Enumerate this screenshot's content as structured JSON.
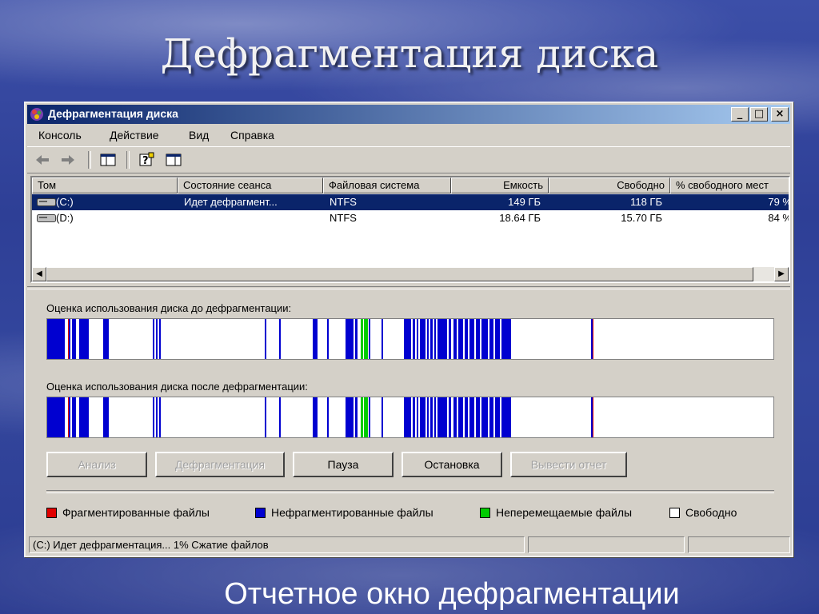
{
  "slide": {
    "title": "Дефрагментация диска",
    "caption": "Отчетное окно  дефрагментации"
  },
  "window": {
    "title": "Дефрагментация диска",
    "controls": {
      "minimize": "_",
      "maximize": "□",
      "close": "×"
    }
  },
  "menu": [
    "Консоль",
    "Действие",
    "Вид",
    "Справка"
  ],
  "toolbar": {
    "icons": [
      "back-arrow-icon",
      "forward-arrow-icon",
      "show-hide-tree-icon",
      "help-icon",
      "properties-icon"
    ]
  },
  "volumes": {
    "columns": [
      "Том",
      "Состояние сеанса",
      "Файловая система",
      "Емкость",
      "Свободно",
      "% свободного мест"
    ],
    "rows": [
      {
        "volume": "(C:)",
        "state": "Идет дефрагмент...",
        "fs": "NTFS",
        "capacity": "149 ГБ",
        "free": "118 ГБ",
        "percent": "79 %",
        "selected": true
      },
      {
        "volume": "(D:)",
        "state": "",
        "fs": "NTFS",
        "capacity": "18.64 ГБ",
        "free": "15.70 ГБ",
        "percent": "84 %",
        "selected": false
      }
    ]
  },
  "analysis": {
    "before_label": "Оценка использования диска до дефрагментации:",
    "after_label": "Оценка использования диска после дефрагментации:"
  },
  "buttons": [
    {
      "label": "Анализ",
      "enabled": false
    },
    {
      "label": "Дефрагментация",
      "enabled": false
    },
    {
      "label": "Пауза",
      "enabled": true
    },
    {
      "label": "Остановка",
      "enabled": true
    },
    {
      "label": "Вывести отчет",
      "enabled": false
    }
  ],
  "legend": [
    {
      "label": "Фрагментированные файлы",
      "color": "#e00000"
    },
    {
      "label": "Нефрагментированные файлы",
      "color": "#0000d0"
    },
    {
      "label": "Неперемещаемые файлы",
      "color": "#00cc00"
    },
    {
      "label": "Свободно",
      "color": "#ffffff"
    }
  ],
  "status": {
    "text": "(C:) Идет дефрагментация... 1%  Сжатие файлов"
  },
  "colors": {
    "fragmented": "#e00000",
    "contiguous": "#0000d0",
    "unmovable": "#00cc00",
    "free": "#ffffff"
  }
}
